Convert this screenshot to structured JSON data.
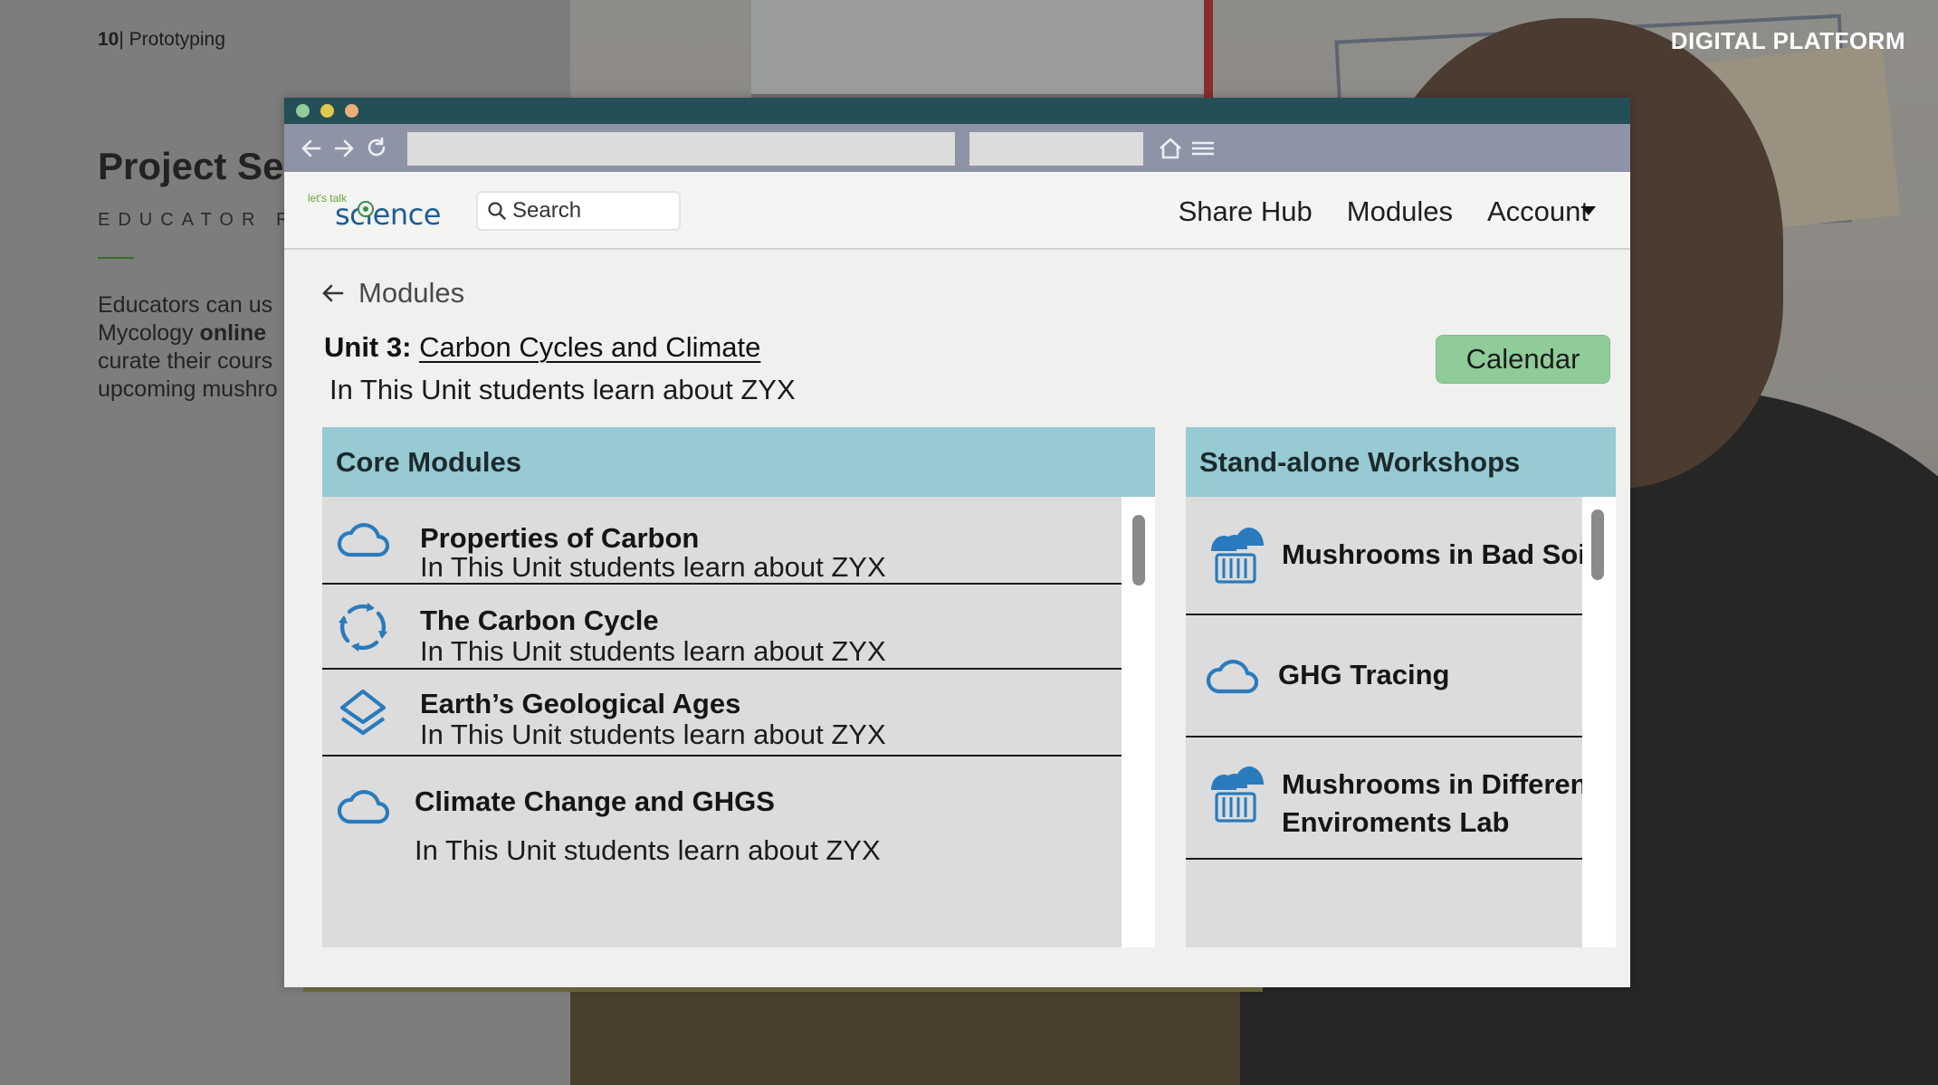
{
  "slide": {
    "number": "10",
    "section": "| Prototyping",
    "tag": "DIGITAL PLATFORM",
    "title": "Project Se",
    "subtitle": "EDUCATOR RE",
    "body_line1": "Educators can us",
    "body_line2a": "Mycology ",
    "body_line2b": "online",
    "body_line3": "curate their cours",
    "body_line4": "upcoming mushro"
  },
  "browser": {
    "dots": [
      "#8fcc9a",
      "#e2c84a",
      "#e8b07a"
    ]
  },
  "app": {
    "logo_small": "let's talk",
    "logo_big": "science",
    "search_placeholder": "Search",
    "nav": [
      "Share Hub",
      "Modules",
      "Account"
    ],
    "back_label": "Modules",
    "unit_prefix": "Unit 3:",
    "unit_title": "Carbon Cycles and Climate",
    "unit_desc": "In This Unit students learn about ZYX",
    "calendar_label": "Calendar",
    "core": {
      "header": "Core Modules",
      "items": [
        {
          "title": "Properties of Carbon",
          "desc": "In This Unit students learn about ZYX",
          "icon": "cloud-icon"
        },
        {
          "title": "The Carbon Cycle",
          "desc": "In This Unit students learn about ZYX",
          "icon": "cycle-icon"
        },
        {
          "title": "Earth’s Geological Ages",
          "desc": "In This Unit students learn about ZYX",
          "icon": "layers-icon"
        },
        {
          "title": "Climate Change and GHGS",
          "desc": "In This Unit students learn about ZYX",
          "icon": "cloud-icon"
        }
      ]
    },
    "workshops": {
      "header": "Stand-alone Workshops",
      "items": [
        {
          "title": "Mushrooms in Bad Soil",
          "icon": "mushroom-icon"
        },
        {
          "title": "GHG Tracing",
          "icon": "cloud-icon"
        },
        {
          "title_line1": "Mushrooms in Different",
          "title_line2": "Enviroments Lab",
          "icon": "mushroom-icon"
        }
      ]
    },
    "colors": {
      "accent": "#2a7bbd",
      "header_teal": "#97cad3",
      "calendar_green": "#8fcc9a",
      "titlebar": "#234f57"
    }
  }
}
